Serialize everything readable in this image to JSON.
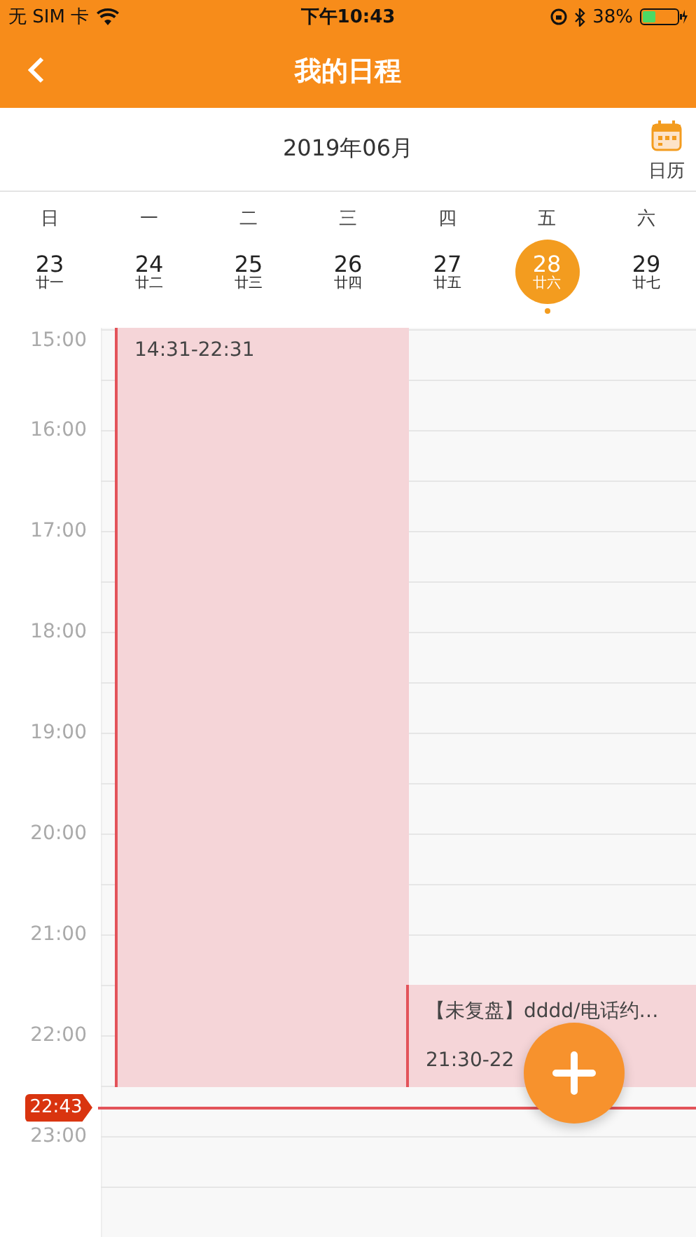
{
  "status_bar": {
    "carrier": "无 SIM 卡",
    "time": "下午10:43",
    "battery": "38%"
  },
  "nav": {
    "title": "我的日程"
  },
  "month_header": {
    "month": "2019年06月",
    "calendar_label": "日历"
  },
  "week": [
    {
      "weekday": "日",
      "date": "23",
      "lunar": "廿一",
      "selected": false,
      "marked": false
    },
    {
      "weekday": "一",
      "date": "24",
      "lunar": "廿二",
      "selected": false,
      "marked": false
    },
    {
      "weekday": "二",
      "date": "25",
      "lunar": "廿三",
      "selected": false,
      "marked": false
    },
    {
      "weekday": "三",
      "date": "26",
      "lunar": "廿四",
      "selected": false,
      "marked": false
    },
    {
      "weekday": "四",
      "date": "27",
      "lunar": "廿五",
      "selected": false,
      "marked": false
    },
    {
      "weekday": "五",
      "date": "28",
      "lunar": "廿六",
      "selected": true,
      "marked": true
    },
    {
      "weekday": "六",
      "date": "29",
      "lunar": "廿七",
      "selected": false,
      "marked": false
    }
  ],
  "hours": [
    "15:00",
    "16:00",
    "17:00",
    "18:00",
    "19:00",
    "20:00",
    "21:00",
    "22:00",
    "23:00"
  ],
  "events": [
    {
      "time": "14:31-22:31"
    },
    {
      "title": "【未复盘】dddd/电话约…",
      "time": "21:30-22"
    }
  ],
  "now_marker": "22:43"
}
